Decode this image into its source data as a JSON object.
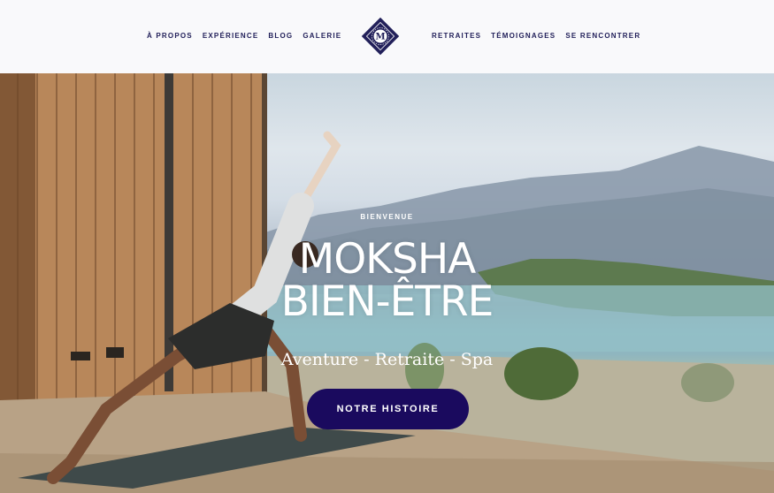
{
  "nav": {
    "left": [
      "À PROPOS",
      "EXPÉRIENCE",
      "BLOG",
      "GALERIE"
    ],
    "right": [
      "RETRAITES",
      "TÉMOIGNAGES",
      "SE RENCONTRER"
    ]
  },
  "logo": {
    "letter": "M",
    "color": "#22205a"
  },
  "hero": {
    "eyebrow": "BIENVENUE",
    "title_line1": "MOKSHA",
    "title_line2": "BIEN-ÊTRE",
    "subtitle": "Aventure - Retraite - Spa",
    "cta_label": "NOTRE HISTOIRE",
    "cta_color": "#1a0a5e"
  }
}
